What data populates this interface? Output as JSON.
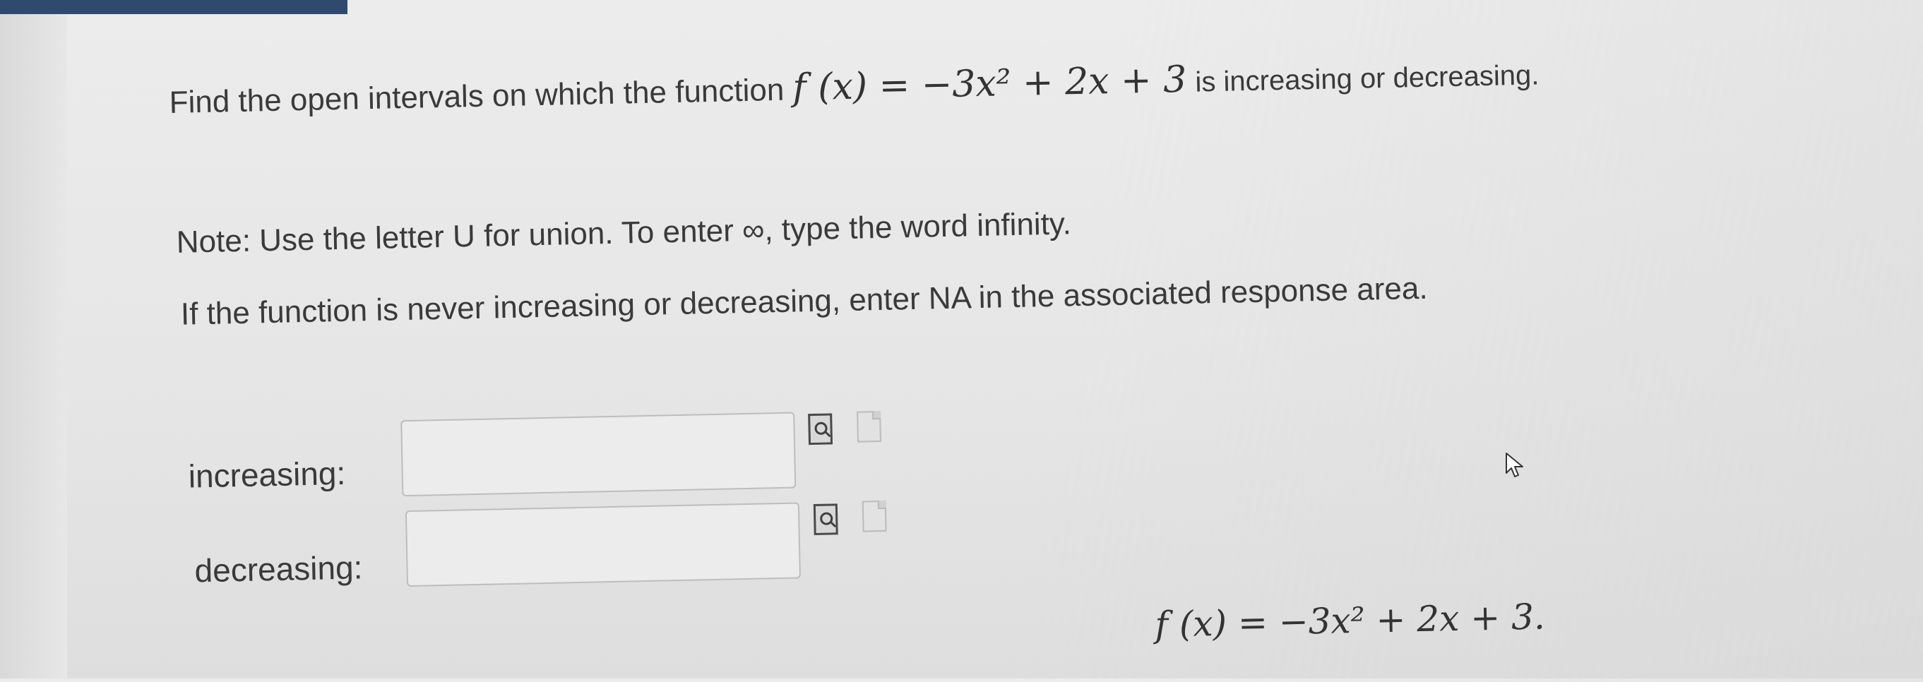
{
  "question": {
    "prefix": "Find the open intervals on which the function",
    "formula": "f (x) = −3x² + 2x + 3",
    "suffix": "is increasing or decreasing."
  },
  "note": "Note: Use the letter U for union. To enter ∞, type the word infinity.",
  "never_text": "If the function is never increasing or decreasing, enter NA in the associated response area.",
  "answers": {
    "increasing_label": "increasing:",
    "increasing_value": "",
    "decreasing_label": "decreasing:",
    "decreasing_value": ""
  },
  "bottom_formula": "f (x) = −3x² + 2x + 3.",
  "icons": {
    "preview": "preview-icon",
    "help": "help-icon",
    "cursor": "cursor-icon"
  }
}
